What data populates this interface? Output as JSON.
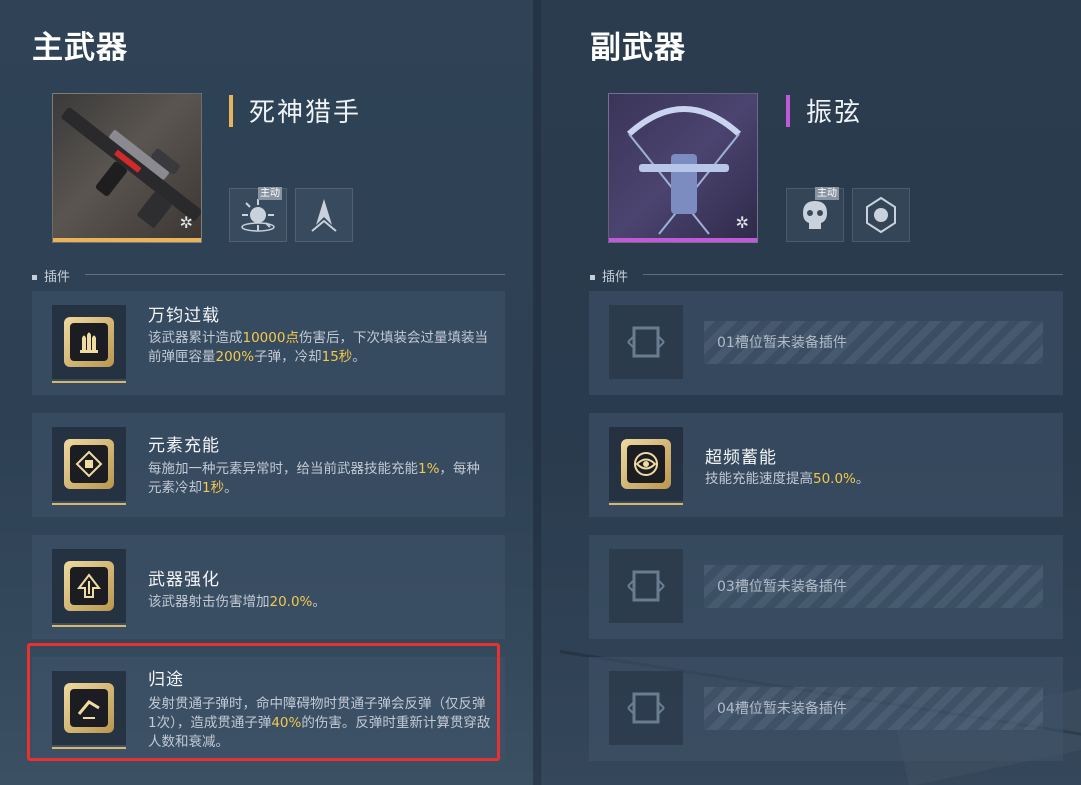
{
  "primary": {
    "title": "主武器",
    "weapon_name": "死神猎手",
    "accent_color": "#e8b35a",
    "skills": [
      {
        "icon": "burst-skill-icon",
        "tag": "主动"
      },
      {
        "icon": "blade-skill-icon"
      }
    ],
    "plugin_section_label": "插件",
    "plugins": [
      {
        "name": "万钧过载",
        "icon": "triple-shell-icon",
        "desc": [
          "该武器累计造成",
          "10000点",
          "伤害后，下次填装会过量填装当前弹匣容量",
          "200%",
          "子弹，冷却",
          "15秒",
          "。"
        ]
      },
      {
        "name": "元素充能",
        "icon": "element-diamond-icon",
        "desc": [
          "每施加一种元素异常时，给当前武器技能充能",
          "1%",
          "，每种元素冷却",
          "1秒",
          "。"
        ]
      },
      {
        "name": "武器强化",
        "icon": "arrow-up-icon",
        "desc": [
          "该武器射击伤害增加",
          "20.0%",
          "。"
        ]
      },
      {
        "name": "归途",
        "icon": "ricochet-icon",
        "desc": [
          "发射贯通子弹时，命中障碍物时贯通子弹会反弹（仅反弹1次），造成贯通子弹",
          "40%",
          "的伤害。反弹时重新计算贯穿敌人数和衰减。"
        ]
      }
    ]
  },
  "secondary": {
    "title": "副武器",
    "weapon_name": "振弦",
    "accent_color": "#c05ad8",
    "skills": [
      {
        "icon": "skull-skill-icon",
        "tag": "主动"
      },
      {
        "icon": "shield-burst-icon"
      }
    ],
    "plugin_section_label": "插件",
    "slots": [
      {
        "empty": true,
        "text": "01槽位暂未装备插件"
      },
      {
        "empty": false,
        "name": "超频蓄能",
        "icon": "eye-ring-icon",
        "desc": [
          "技能充能速度提高",
          "50.0%",
          "。"
        ]
      },
      {
        "empty": true,
        "text": "03槽位暂未装备插件"
      },
      {
        "empty": true,
        "text": "04槽位暂未装备插件"
      }
    ]
  },
  "highlight_color": "#e8322f"
}
